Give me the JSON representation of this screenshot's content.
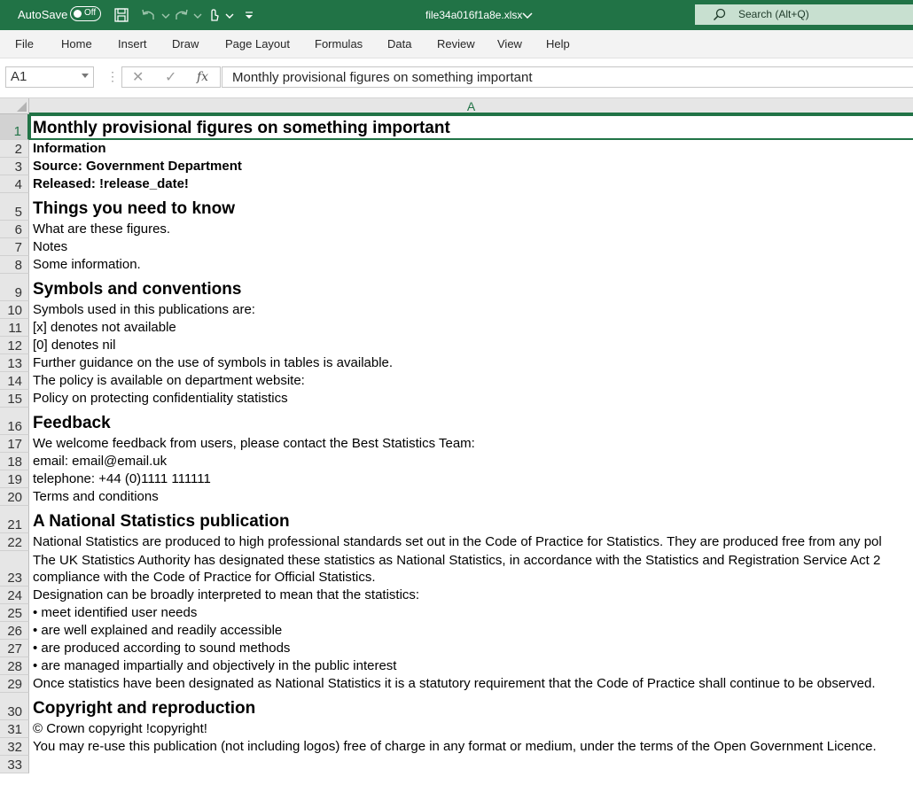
{
  "titlebar": {
    "autosave_label": "AutoSave",
    "autosave_state": "Off",
    "filename": "file34a016f1a8e.xlsx",
    "search_placeholder": "Search (Alt+Q)",
    "icons": [
      "save-icon",
      "undo-icon",
      "redo-icon",
      "touch-mode-icon",
      "customize-qat-icon",
      "search-icon"
    ]
  },
  "ribbon": {
    "tabs": [
      "File",
      "Home",
      "Insert",
      "Draw",
      "Page Layout",
      "Formulas",
      "Data",
      "Review",
      "View",
      "Help"
    ]
  },
  "formula_bar": {
    "name_box": "A1",
    "cancel_symbol": "✕",
    "enter_symbol": "✓",
    "fx_symbol": "fx",
    "content": "Monthly provisional figures on something important"
  },
  "sheet": {
    "column_header": "A",
    "rows": [
      {
        "n": "1",
        "text": "Monthly provisional figures on something important"
      },
      {
        "n": "2",
        "text": "Information"
      },
      {
        "n": "3",
        "text": "Source: Government Department"
      },
      {
        "n": "4",
        "text": "Released: !release_date!"
      },
      {
        "n": "5",
        "text": "Things you need to know"
      },
      {
        "n": "6",
        "text": "What are these figures."
      },
      {
        "n": "7",
        "text": "Notes"
      },
      {
        "n": "8",
        "text": "Some information."
      },
      {
        "n": "9",
        "text": "Symbols and conventions"
      },
      {
        "n": "10",
        "text": "Symbols used in this publications are:"
      },
      {
        "n": "11",
        "text": "[x] denotes not available"
      },
      {
        "n": "12",
        "text": "[0] denotes nil"
      },
      {
        "n": "13",
        "text": "Further guidance on the use of symbols in tables is available."
      },
      {
        "n": "14",
        "text": "The policy is available on department website:"
      },
      {
        "n": "15",
        "text": "Policy on protecting confidentiality statistics"
      },
      {
        "n": "16",
        "text": "Feedback"
      },
      {
        "n": "17",
        "text": "We welcome feedback from users, please contact the Best Statistics Team:"
      },
      {
        "n": "18",
        "text": "email: email@email.uk"
      },
      {
        "n": "19",
        "text": "telephone: +44 (0)1111 111111"
      },
      {
        "n": "20",
        "text": "Terms and conditions"
      },
      {
        "n": "21",
        "text": "A National Statistics publication"
      },
      {
        "n": "22",
        "text": "National Statistics are produced to high professional standards set out in the Code of Practice for Statistics. They are produced free from any pol"
      },
      {
        "n": "23",
        "line1": "The UK Statistics Authority has designated these statistics as National Statistics, in accordance with the Statistics and Registration Service Act 2",
        "line2": "compliance with the Code of Practice for Official Statistics."
      },
      {
        "n": "24",
        "text": "Designation can be broadly interpreted to mean that the statistics:"
      },
      {
        "n": "25",
        "text": "• meet identified user needs"
      },
      {
        "n": "26",
        "text": "• are well explained and readily accessible"
      },
      {
        "n": "27",
        "text": "• are produced according to sound methods"
      },
      {
        "n": "28",
        "text": "• are managed impartially and objectively in the public interest"
      },
      {
        "n": "29",
        "text": "Once statistics have been designated as National Statistics it is a statutory requirement that the Code of Practice shall continue to be observed."
      },
      {
        "n": "30",
        "text": "Copyright and reproduction"
      },
      {
        "n": "31",
        "text": "© Crown copyright !copyright!"
      },
      {
        "n": "32",
        "text": "You may re-use this publication (not including logos) free of charge in any format or medium, under the terms of the Open Government Licence."
      },
      {
        "n": "33",
        "text": ""
      }
    ]
  },
  "colors": {
    "excel_green": "#217346",
    "ribbon_bg": "#f3f3f3",
    "header_bg": "#e6e6e6"
  }
}
